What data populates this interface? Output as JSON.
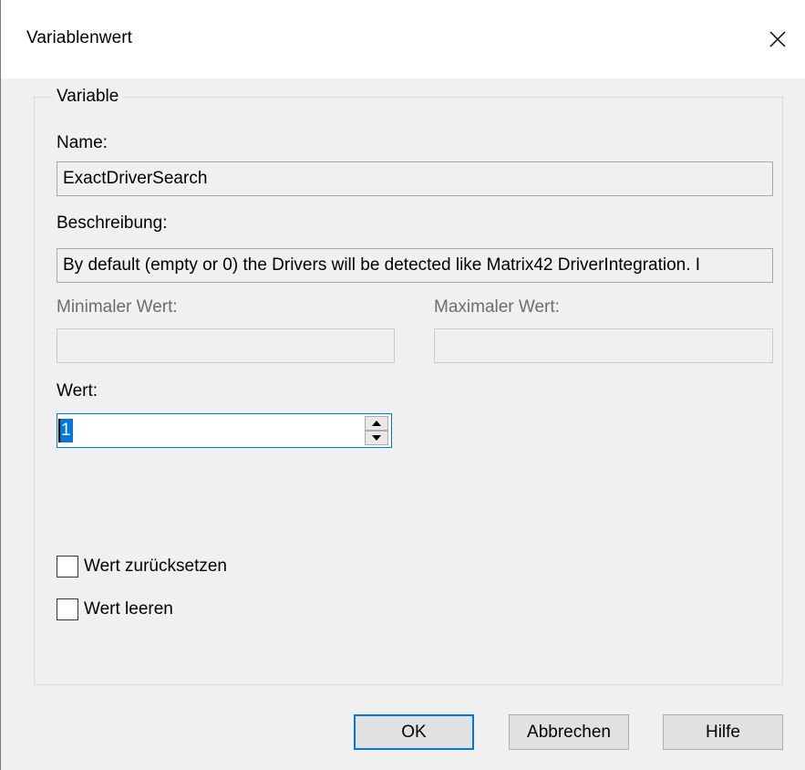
{
  "window": {
    "title": "Variablenwert"
  },
  "group": {
    "legend": "Variable"
  },
  "fields": {
    "name_label": "Name:",
    "name_value": "ExactDriverSearch",
    "description_label": "Beschreibung:",
    "description_value": "By default (empty or 0) the Drivers will be detected like Matrix42 DriverIntegration. I",
    "min_label": "Minimaler Wert:",
    "min_value": "",
    "max_label": "Maximaler Wert:",
    "max_value": "",
    "value_label": "Wert:",
    "value_value": "1"
  },
  "checkboxes": {
    "reset_label": "Wert zurücksetzen",
    "reset_checked": false,
    "clear_label": "Wert leeren",
    "clear_checked": false
  },
  "buttons": {
    "ok_label": "OK",
    "cancel_label": "Abbrechen",
    "help_label": "Hilfe"
  },
  "colors": {
    "accent": "#0078d7",
    "dialog_bg": "#f0f0f0"
  },
  "icons": {
    "close": "close-icon",
    "spin_up": "triangle-up-icon",
    "spin_down": "triangle-down-icon"
  }
}
